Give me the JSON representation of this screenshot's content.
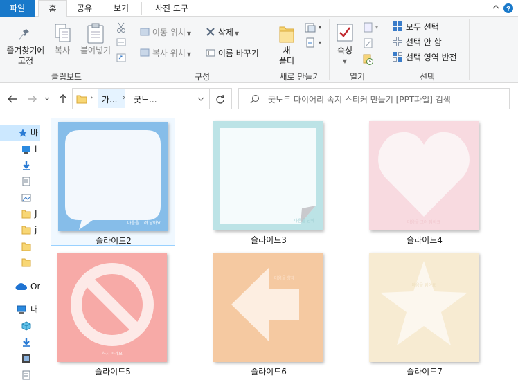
{
  "tabs": {
    "file": "파일",
    "home": "홈",
    "share": "공유",
    "view": "보기",
    "picture_tools": "사진 도구"
  },
  "ribbon": {
    "clipboard": {
      "pin_label_1": "즐겨찾기에",
      "pin_label_2": "고정",
      "copy": "복사",
      "paste": "붙여넣기",
      "group": "클립보드"
    },
    "organize": {
      "move_to": "이동 위치",
      "copy_to": "복사 위치",
      "delete": "삭제",
      "rename": "이름 바꾸기",
      "group": "구성"
    },
    "new": {
      "new_folder_1": "새",
      "new_folder_2": "폴더",
      "group": "새로 만들기"
    },
    "open": {
      "properties": "속성",
      "group": "열기"
    },
    "select": {
      "select_all": "모두 선택",
      "select_none": "선택 안 함",
      "invert": "선택 영역 반전",
      "group": "선택"
    }
  },
  "address": {
    "crumb1": "가...",
    "crumb2": "굿노..."
  },
  "search": {
    "placeholder": "굿노트 다이어리 속지 스티커 만들기 [PPT파일] 검색"
  },
  "leftnav": {
    "quick_access": "바",
    "onedrive": "On",
    "this_pc": "내",
    "folder_j1": "J",
    "folder_j2": "j"
  },
  "files": [
    {
      "name": "슬라이드2",
      "caption": "마음을 그려 담아요"
    },
    {
      "name": "슬라이드3",
      "caption": "마음을 담아"
    },
    {
      "name": "슬라이드4",
      "caption": "마음을 그려 담아요"
    },
    {
      "name": "슬라이드5",
      "caption": "하지 마세요"
    },
    {
      "name": "슬라이드6",
      "caption": "마음을 향해"
    },
    {
      "name": "슬라이드7",
      "caption": "마음을 담아요"
    }
  ],
  "colors": {
    "file_tab": "#1979ca",
    "thumb2": "#86bde9",
    "thumb3": "#bce3e6",
    "thumb4": "#f8dae0",
    "thumb5": "#f7aaa7",
    "thumb6": "#f5c9a1",
    "thumb7": "#f7ebd2"
  }
}
